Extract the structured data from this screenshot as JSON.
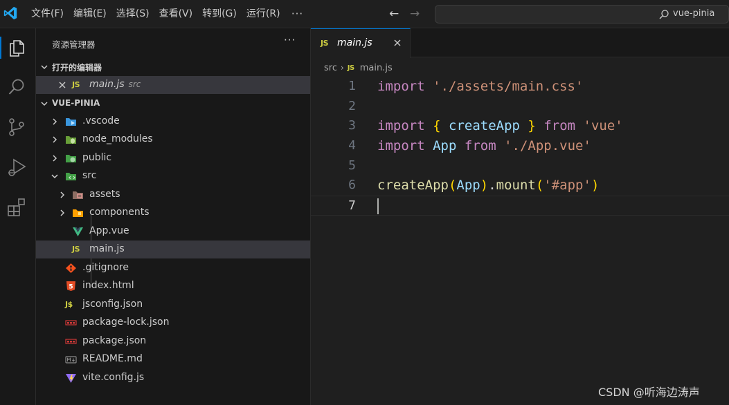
{
  "menu": {
    "items": [
      "文件(F)",
      "编辑(E)",
      "选择(S)",
      "查看(V)",
      "转到(G)",
      "运行(R)"
    ],
    "more": "···"
  },
  "search": {
    "text": "vue-pinia"
  },
  "sidebar": {
    "title": "资源管理器",
    "more": "···",
    "open_editors": {
      "header": "打开的编辑器",
      "items": [
        {
          "badge": "JS",
          "name": "main.js",
          "desc": "src"
        }
      ]
    },
    "project": {
      "header": "VUE-PINIA",
      "items": [
        {
          "name": ".vscode",
          "icon": "vscode-folder-icon",
          "color": "#3a96dd"
        },
        {
          "name": "node_modules",
          "icon": "node-folder-icon",
          "color": "#8bc34a"
        },
        {
          "name": "public",
          "icon": "public-folder-icon",
          "color": "#4caf50"
        },
        {
          "name": "src",
          "icon": "src-folder-icon",
          "color": "#4caf50"
        },
        {
          "name": "assets",
          "icon": "assets-folder-icon",
          "color": "#e57373"
        },
        {
          "name": "components",
          "icon": "components-folder-icon",
          "color": "#ffb300"
        },
        {
          "name": "App.vue",
          "icon": "vue-file-icon",
          "color": "#41b883"
        },
        {
          "name": "main.js",
          "icon": "js-file-icon",
          "badge": "JS"
        },
        {
          "name": ".gitignore",
          "icon": "git-file-icon",
          "color": "#f4511e"
        },
        {
          "name": "index.html",
          "icon": "html-file-icon",
          "badge": "5",
          "color": "#e44d26"
        },
        {
          "name": "jsconfig.json",
          "icon": "jsconfig-file-icon",
          "badge": "J$",
          "color": "#cbcb41"
        },
        {
          "name": "package-lock.json",
          "icon": "npm-file-icon",
          "badge": "npm",
          "color": "#cb3837"
        },
        {
          "name": "package.json",
          "icon": "npm-file-icon",
          "badge": "npm",
          "color": "#cb3837"
        },
        {
          "name": "README.md",
          "icon": "markdown-file-icon",
          "badge": "M↓",
          "color": "#8a8a8a"
        },
        {
          "name": "vite.config.js",
          "icon": "vite-file-icon",
          "color": "#9f5fff"
        }
      ]
    }
  },
  "editor": {
    "tab": {
      "badge": "JS",
      "label": "main.js"
    },
    "breadcrumb": {
      "folder": "src",
      "sep": "›",
      "badge": "JS",
      "file": "main.js"
    },
    "line_numbers": [
      "1",
      "2",
      "3",
      "4",
      "5",
      "6",
      "7"
    ],
    "code": {
      "l1": {
        "kw": "import",
        "str": "'./assets/main.css'"
      },
      "l3": {
        "kw": "import",
        "ob": "{",
        "name": "createApp",
        "cb": "}",
        "from": "from",
        "str": "'vue'"
      },
      "l4": {
        "kw": "import",
        "name": "App",
        "from": "from",
        "str": "'./App.vue'"
      },
      "l6": {
        "fn": "createApp",
        "op": "(",
        "arg": "App",
        "cp": ")",
        "dot": ".",
        "method": "mount",
        "op2": "(",
        "str": "'#app'",
        "cp2": ")"
      }
    }
  },
  "watermark": "CSDN @听海边涛声",
  "colors": {
    "accent": "#0078d4",
    "keyword": "#c586c0",
    "string": "#ce9178",
    "variable": "#9cdcfe",
    "function": "#dcdcaa"
  }
}
